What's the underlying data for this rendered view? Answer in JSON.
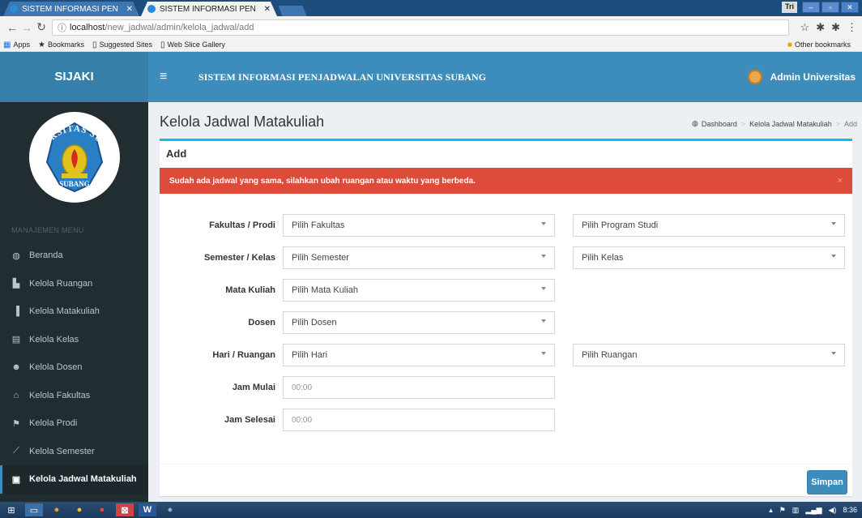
{
  "browser": {
    "tabs": [
      {
        "label": "SISTEM INFORMASI PEN",
        "active": false
      },
      {
        "label": "SISTEM INFORMASI PEN",
        "active": true
      }
    ],
    "user_badge": "Tri",
    "url_host": "localhost",
    "url_path": "/new_jadwal/admin/kelola_jadwal/add",
    "bookmarks": [
      {
        "label": "Apps",
        "icon": "apps-grid-icon"
      },
      {
        "label": "Bookmarks",
        "icon": "star-icon"
      },
      {
        "label": "Suggested Sites",
        "icon": "page-icon"
      },
      {
        "label": "Web Slice Gallery",
        "icon": "page-icon"
      }
    ],
    "other_bookmarks": "Other bookmarks"
  },
  "header": {
    "brand": "SIJAKI",
    "title": "SISTEM INFORMASI PENJADWALAN UNIVERSITAS SUBANG",
    "user": "Admin Universitas"
  },
  "sidebar": {
    "seal_text_top": "UNIVERSITAS SUBANG",
    "seal_text_bottom": "SUBANG",
    "menu_header": "MANAJEMEN MENU",
    "items": [
      {
        "label": "Beranda",
        "icon": "dashboard-icon"
      },
      {
        "label": "Kelola Ruangan",
        "icon": "building-icon"
      },
      {
        "label": "Kelola Matakuliah",
        "icon": "bookmark-icon"
      },
      {
        "label": "Kelola Kelas",
        "icon": "file-icon"
      },
      {
        "label": "Kelola Dosen",
        "icon": "users-icon"
      },
      {
        "label": "Kelola Fakultas",
        "icon": "graduation-cap-icon"
      },
      {
        "label": "Kelola Prodi",
        "icon": "flag-icon"
      },
      {
        "label": "Kelola Semester",
        "icon": "line-chart-icon"
      },
      {
        "label": "Kelola Jadwal Matakuliah",
        "icon": "calendar-icon",
        "active": true
      }
    ]
  },
  "page": {
    "title": "Kelola Jadwal Matakuliah",
    "breadcrumb": [
      "Dashboard",
      "Kelola Jadwal Matakuliah",
      "Add"
    ],
    "box_title": "Add",
    "alert": "Sudah ada jadwal yang sama, silahkan ubah ruangan atau waktu yang berbeda.",
    "alert_close": "×",
    "form": {
      "fakultas_label": "Fakultas / Prodi",
      "fakultas_value": "Pilih Fakultas",
      "prodi_value": "Pilih Program Studi",
      "semester_label": "Semester / Kelas",
      "semester_value": "Pilih Semester",
      "kelas_value": "Pilih Kelas",
      "matkul_label": "Mata Kuliah",
      "matkul_value": "Pilih Mata Kuliah",
      "dosen_label": "Dosen",
      "dosen_value": "Pilih Dosen",
      "hari_label": "Hari / Ruangan",
      "hari_value": "Pilih Hari",
      "ruangan_value": "Pilih Ruangan",
      "jam_mulai_label": "Jam Mulai",
      "jam_mulai_placeholder": "00:00",
      "jam_selesai_label": "Jam Selesai",
      "jam_selesai_placeholder": "00:00"
    },
    "submit": "Simpan"
  },
  "taskbar": {
    "time": "8:36"
  },
  "colors": {
    "header": "#3c8dbc",
    "brand": "#367fa9",
    "sidebar": "#222d32",
    "alert": "#dd4b39",
    "box_accent": "#00c0ef"
  }
}
